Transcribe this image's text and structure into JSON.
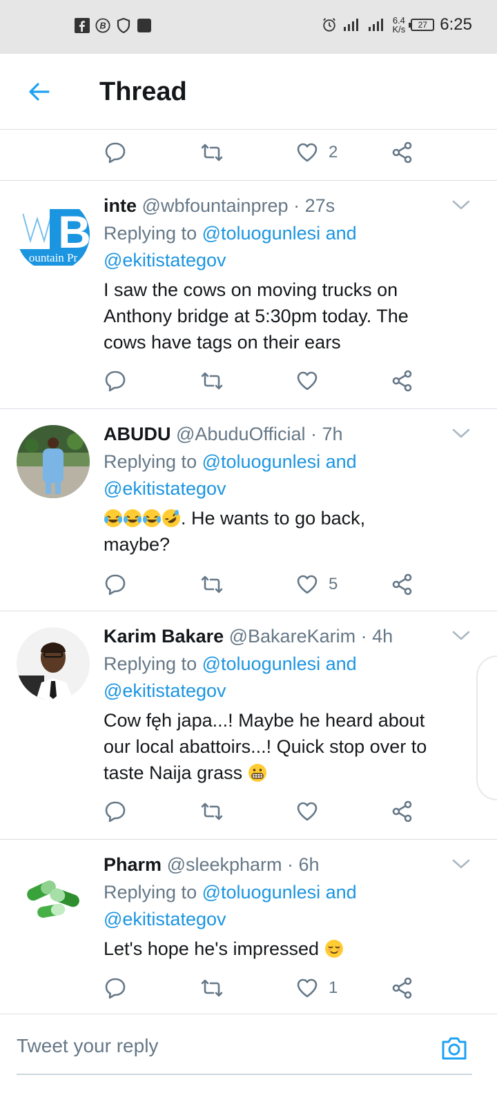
{
  "status_bar": {
    "left_icons": [
      "facebook-icon",
      "b-circle-icon",
      "shield-icon",
      "square-icon"
    ],
    "right_icons": [
      "alarm-icon",
      "signal-icon",
      "signal-icon"
    ],
    "speed_value": "6.4",
    "speed_unit": "K/s",
    "battery": "27",
    "time": "6:25"
  },
  "header": {
    "title": "Thread"
  },
  "top_actions": {
    "like_count": "2"
  },
  "tweets": [
    {
      "name": "inte",
      "handle": "@wbfountainprep · 27s",
      "replying_prefix": "Replying to",
      "replying_user1": "@toluogunlesi and",
      "replying_user2": "@ekitistategov",
      "text_lines": [
        "I saw the cows on moving trucks on",
        "Anthony bridge at 5:30pm today. The",
        "cows have tags on  their ears"
      ],
      "like_count": "",
      "avatar_text": "B",
      "avatar_subtext": "ountain Pr"
    },
    {
      "name": "ABUDU",
      "handle": "@AbuduOfficial · 7h",
      "replying_prefix": "Replying to",
      "replying_user1": "@toluogunlesi and",
      "replying_user2": "@ekitistategov",
      "text_line1": ". He wants to go back,",
      "text_line2": "maybe?",
      "like_count": "5"
    },
    {
      "name": "Karim Bakare",
      "handle": "@BakareKarim · 4h",
      "replying_prefix": "Replying to",
      "replying_user1": "@toluogunlesi and",
      "replying_user2": "@ekitistategov",
      "text_lines": [
        "Cow fęh japa...! Maybe he heard about",
        "our local abattoirs...! Quick stop over to"
      ],
      "text_last": "taste Naija grass",
      "like_count": ""
    },
    {
      "name": "Pharm",
      "handle": "@sleekpharm · 6h",
      "replying_prefix": "Replying to",
      "replying_user1": "@toluogunlesi and",
      "replying_user2": "@ekitistategov",
      "text_line": "Let's hope he's impressed",
      "like_count": "1"
    }
  ],
  "reply_bar": {
    "placeholder": "Tweet your reply"
  },
  "colors": {
    "accent": "#1da1f2",
    "link": "#1b95e0",
    "muted": "#657786",
    "divider": "#d9dde1"
  }
}
